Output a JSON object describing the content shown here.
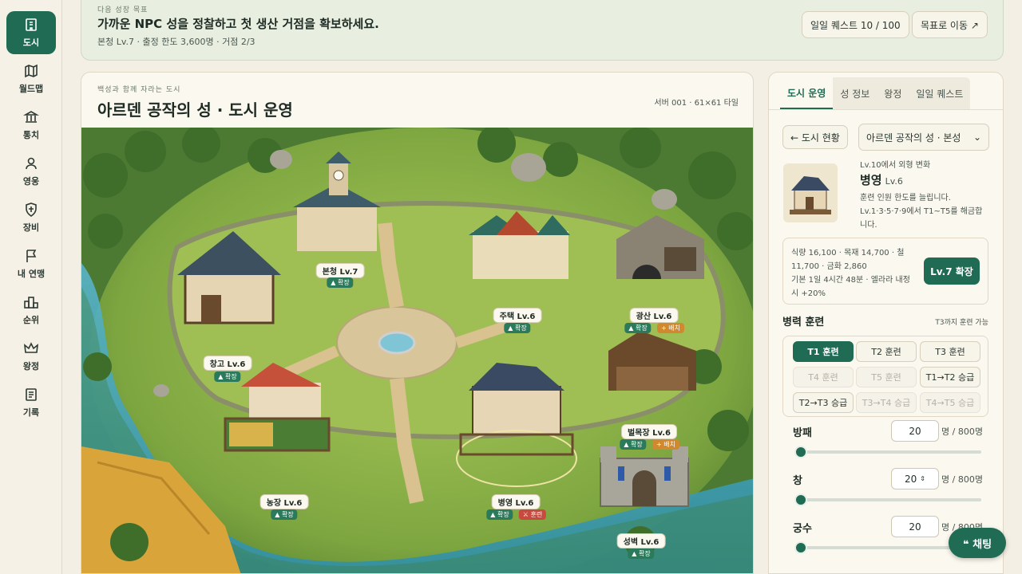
{
  "sidebar": {
    "items": [
      {
        "label": "도시",
        "icon": "city-icon",
        "active": true
      },
      {
        "label": "월드맵",
        "icon": "map-icon"
      },
      {
        "label": "통치",
        "icon": "government-icon"
      },
      {
        "label": "영웅",
        "icon": "hero-icon"
      },
      {
        "label": "장비",
        "icon": "shield-icon"
      },
      {
        "label": "내 연맹",
        "icon": "flag-icon"
      },
      {
        "label": "순위",
        "icon": "ranking-icon"
      },
      {
        "label": "왕정",
        "icon": "crown-icon"
      },
      {
        "label": "기록",
        "icon": "record-icon"
      }
    ]
  },
  "goal": {
    "subtitle": "다음 성장 목표",
    "title": "가까운 NPC 성을 정찰하고 첫 생산 거점을 확보하세요.",
    "meta": "본청 Lv.7 · 출정 한도 3,600명 · 거점 2/3",
    "daily_quest_label": "일일 퀘스트 10 / 100",
    "goto_goal_label": "목표로 이동 ↗"
  },
  "main": {
    "subtitle": "백성과 함께 자라는 도시",
    "title": "아르덴 공작의 성 · 도시 운영",
    "server_meta": "서버 001 · 61×61 타일",
    "buildings": [
      {
        "name": "본청",
        "level": "Lv.7",
        "badges": [
          {
            "text": "▲ 확장",
            "kind": "g"
          }
        ]
      },
      {
        "name": "주택",
        "level": "Lv.6",
        "badges": [
          {
            "text": "▲ 확장",
            "kind": "g"
          }
        ]
      },
      {
        "name": "광산",
        "level": "Lv.6",
        "badges": [
          {
            "text": "▲ 확장",
            "kind": "g"
          },
          {
            "text": "+ 배치",
            "kind": "o"
          }
        ]
      },
      {
        "name": "창고",
        "level": "Lv.6",
        "badges": [
          {
            "text": "▲ 확장",
            "kind": "g"
          }
        ]
      },
      {
        "name": "벌목장",
        "level": "Lv.6",
        "badges": [
          {
            "text": "▲ 확장",
            "kind": "g"
          },
          {
            "text": "+ 배치",
            "kind": "o"
          }
        ]
      },
      {
        "name": "농장",
        "level": "Lv.6",
        "badges": [
          {
            "text": "▲ 확장",
            "kind": "g"
          }
        ]
      },
      {
        "name": "병영",
        "level": "Lv.6",
        "badges": [
          {
            "text": "▲ 확장",
            "kind": "g"
          },
          {
            "text": "⚔ 훈련",
            "kind": "r"
          }
        ]
      },
      {
        "name": "성벽",
        "level": "Lv.6",
        "badges": [
          {
            "text": "▲ 확장",
            "kind": "g"
          }
        ]
      }
    ]
  },
  "panel": {
    "tabs": [
      "도시 운영",
      "성 정보",
      "왕정",
      "일일 퀘스트"
    ],
    "back_label": "← 도시 현황",
    "city_select": "아르덴 공작의 성 · 본성",
    "appearance_note": "Lv.10에서 외형 변화",
    "building_name": "병영",
    "building_level": "Lv.6",
    "desc1": "훈련 인원 한도를 늘립니다.",
    "desc2": "Lv.1·3·5·7·9에서 T1~T5를 해금합",
    "desc3": "니다.",
    "cost1": "식량 16,100 · 목재 14,700 · 철",
    "cost2": "11,700 · 금화 2,860",
    "cost3": "기본 1일 4시간 48분 · 엘라라 내정",
    "cost4": "시 +20%",
    "upgrade_label": "Lv.7 확장",
    "training_title": "병력 훈련",
    "training_note": "T3까지 훈련 가능",
    "training_buttons": [
      "T1 훈련",
      "T2 훈련",
      "T3 훈련",
      "T4 훈련",
      "T5 훈련",
      "T1→T2 승급",
      "T2→T3 승급",
      "T3→T4 승급",
      "T4→T5 승급"
    ],
    "units": [
      {
        "name": "방패",
        "value": "20",
        "max": "명 / 800명"
      },
      {
        "name": "창",
        "value": "20",
        "max": "명 / 800명"
      },
      {
        "name": "궁수",
        "value": "20",
        "max": "명 / 800명"
      }
    ]
  },
  "chat_label": "❝ 채팅"
}
